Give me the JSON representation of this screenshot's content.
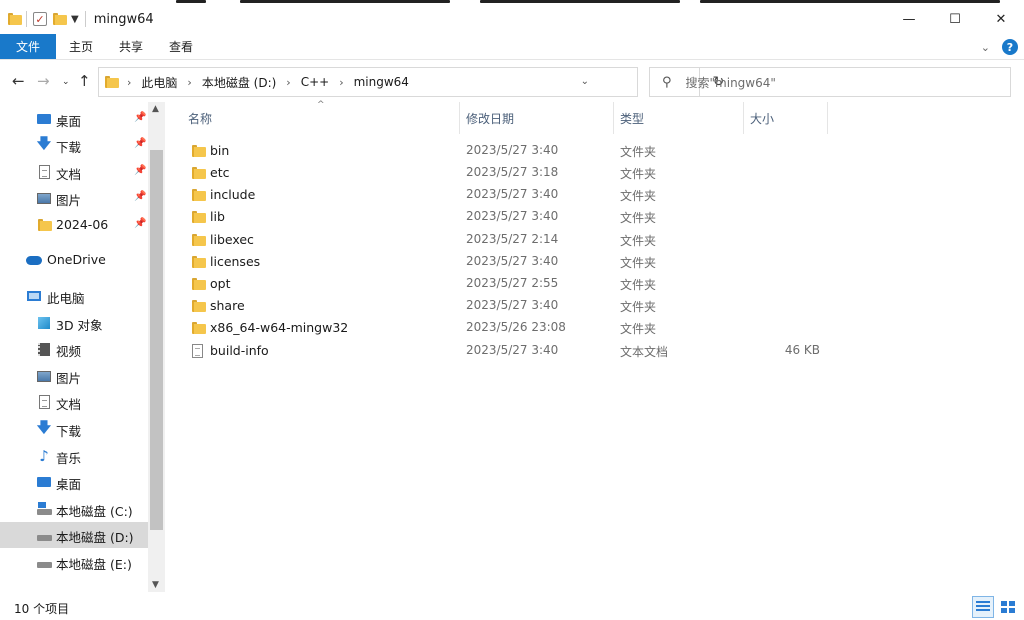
{
  "window": {
    "title": "mingw64",
    "controls": {
      "minimize": "—",
      "maximize": "☐",
      "close": "✕"
    }
  },
  "ribbon": {
    "tabs": [
      "文件",
      "主页",
      "共享",
      "查看"
    ],
    "help": "?"
  },
  "address": {
    "breadcrumbs": [
      "此电脑",
      "本地磁盘 (D:)",
      "C++",
      "mingw64"
    ],
    "refresh": "↻"
  },
  "search": {
    "placeholder": "搜索\"mingw64\""
  },
  "sidebar": {
    "quick_access": [
      {
        "label": "桌面",
        "icon": "desktop-icon",
        "pinned": true
      },
      {
        "label": "下载",
        "icon": "download-icon",
        "pinned": true
      },
      {
        "label": "文档",
        "icon": "document-icon",
        "pinned": true
      },
      {
        "label": "图片",
        "icon": "picture-icon",
        "pinned": true
      },
      {
        "label": "2024-06",
        "icon": "folder-icon",
        "pinned": true
      }
    ],
    "onedrive": "OneDrive",
    "this_pc": "此电脑",
    "pc_items": [
      {
        "label": "3D 对象",
        "icon": "3d-objects-icon"
      },
      {
        "label": "视频",
        "icon": "video-icon"
      },
      {
        "label": "图片",
        "icon": "picture-icon"
      },
      {
        "label": "文档",
        "icon": "document-icon"
      },
      {
        "label": "下载",
        "icon": "download-icon"
      },
      {
        "label": "音乐",
        "icon": "music-icon"
      },
      {
        "label": "桌面",
        "icon": "desktop-icon"
      },
      {
        "label": "本地磁盘 (C:)",
        "icon": "windows-drive-icon"
      },
      {
        "label": "本地磁盘 (D:)",
        "icon": "drive-icon",
        "selected": true
      },
      {
        "label": "本地磁盘 (E:)",
        "icon": "drive-icon"
      }
    ]
  },
  "columns": {
    "name": "名称",
    "date": "修改日期",
    "type": "类型",
    "size": "大小"
  },
  "files": [
    {
      "name": "bin",
      "date": "2023/5/27 3:40",
      "type": "文件夹",
      "size": "",
      "kind": "folder"
    },
    {
      "name": "etc",
      "date": "2023/5/27 3:18",
      "type": "文件夹",
      "size": "",
      "kind": "folder"
    },
    {
      "name": "include",
      "date": "2023/5/27 3:40",
      "type": "文件夹",
      "size": "",
      "kind": "folder"
    },
    {
      "name": "lib",
      "date": "2023/5/27 3:40",
      "type": "文件夹",
      "size": "",
      "kind": "folder"
    },
    {
      "name": "libexec",
      "date": "2023/5/27 2:14",
      "type": "文件夹",
      "size": "",
      "kind": "folder"
    },
    {
      "name": "licenses",
      "date": "2023/5/27 3:40",
      "type": "文件夹",
      "size": "",
      "kind": "folder"
    },
    {
      "name": "opt",
      "date": "2023/5/27 2:55",
      "type": "文件夹",
      "size": "",
      "kind": "folder"
    },
    {
      "name": "share",
      "date": "2023/5/27 3:40",
      "type": "文件夹",
      "size": "",
      "kind": "folder"
    },
    {
      "name": "x86_64-w64-mingw32",
      "date": "2023/5/26 23:08",
      "type": "文件夹",
      "size": "",
      "kind": "folder"
    },
    {
      "name": "build-info",
      "date": "2023/5/27 3:40",
      "type": "文本文档",
      "size": "46 KB",
      "kind": "text"
    }
  ],
  "status": {
    "item_count": "10 个项目"
  },
  "colors": {
    "accent": "#1979ca",
    "selected_nav": "#d9d9d9"
  }
}
